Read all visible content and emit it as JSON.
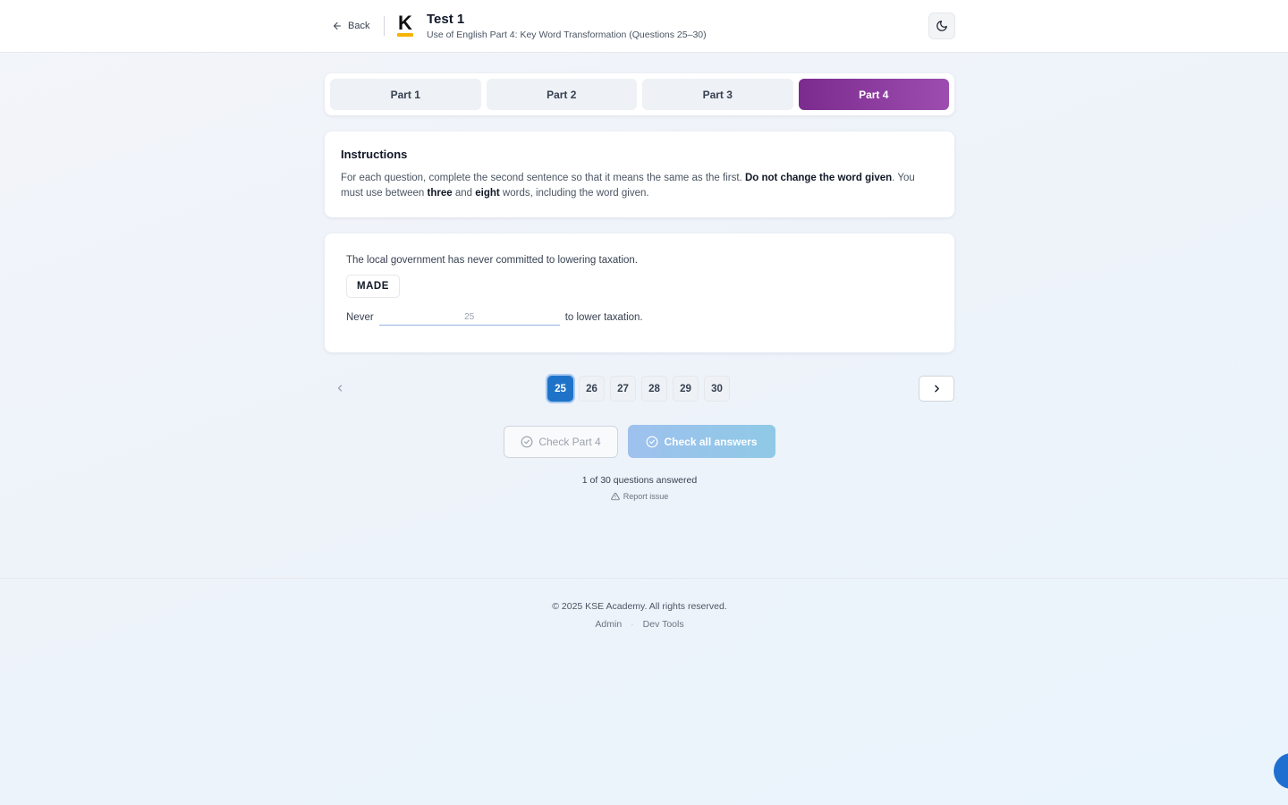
{
  "header": {
    "back_label": "Back",
    "logo_letter": "K",
    "title": "Test 1",
    "subtitle": "Use of English Part 4: Key Word Transformation (Questions 25–30)"
  },
  "tabs": [
    {
      "label": "Part 1",
      "active": false
    },
    {
      "label": "Part 2",
      "active": false
    },
    {
      "label": "Part 3",
      "active": false
    },
    {
      "label": "Part 4",
      "active": true
    }
  ],
  "instructions": {
    "heading": "Instructions",
    "text_1": "For each question, complete the second sentence so that it means the same as the first. ",
    "bold_1": "Do not change the word given",
    "text_2": ". You must use between ",
    "bold_2": "three",
    "text_3": " and ",
    "bold_3": "eight",
    "text_4": " words, including the word given."
  },
  "question": {
    "sentence": "The local government has never committed to lowering taxation.",
    "keyword": "MADE",
    "prefix": "Never",
    "input_value": "",
    "input_placeholder": "25",
    "suffix": "to lower taxation."
  },
  "pager": {
    "pages": [
      "25",
      "26",
      "27",
      "28",
      "29",
      "30"
    ],
    "current": "25"
  },
  "actions": {
    "check_part_label": "Check Part 4",
    "check_all_label": "Check all answers"
  },
  "status": {
    "progress": "1 of 30 questions answered",
    "report_label": "Report issue"
  },
  "footer": {
    "copyright": "© 2025 KSE Academy. All rights reserved.",
    "link_admin": "Admin",
    "separator": "·",
    "link_dev": "Dev Tools"
  },
  "colors": {
    "accent_purple": "#7b2b8e",
    "active_page_blue": "#1e73c9",
    "logo_yellow": "#f5b400"
  },
  "icons": {
    "back": "arrow-left-icon",
    "theme": "moon-icon",
    "prev": "chevron-left-icon",
    "next": "chevron-right-icon",
    "check": "check-circle-icon",
    "report": "warning-triangle-icon"
  }
}
